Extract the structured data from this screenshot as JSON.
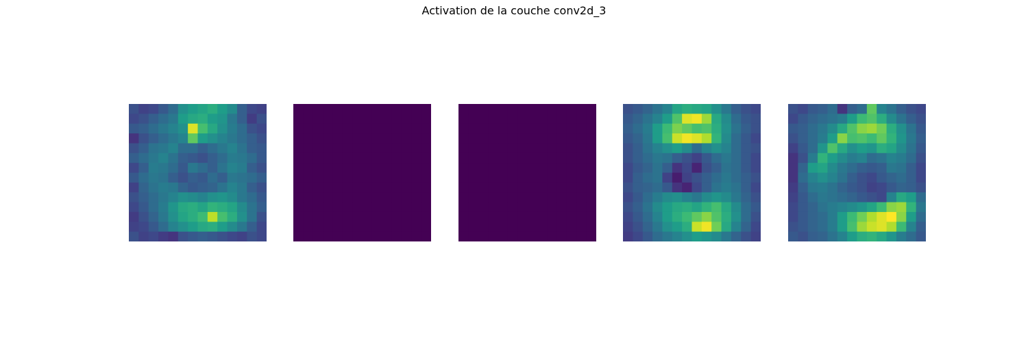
{
  "figure": {
    "title": "Activation de la couche conv2d_3"
  },
  "colormap": [
    "#440154",
    "#482878",
    "#3e4989",
    "#31688e",
    "#26828e",
    "#1f9e89",
    "#35b779",
    "#6ece58",
    "#b5de2b",
    "#fde725"
  ],
  "chart_data": {
    "type": "heatmap",
    "title": "Activation de la couche conv2d_3",
    "xlabel": "",
    "ylabel": "",
    "axes_visible": false,
    "grid": false,
    "colormap_name": "viridis",
    "value_range": [
      0,
      1
    ],
    "panels": [
      {
        "rows": 14,
        "cols": 14,
        "values": [
          [
            0.25,
            0.2,
            0.22,
            0.28,
            0.35,
            0.5,
            0.55,
            0.58,
            0.62,
            0.55,
            0.48,
            0.3,
            0.22,
            0.2
          ],
          [
            0.22,
            0.25,
            0.3,
            0.35,
            0.4,
            0.55,
            0.6,
            0.62,
            0.55,
            0.52,
            0.4,
            0.3,
            0.18,
            0.25
          ],
          [
            0.28,
            0.3,
            0.35,
            0.4,
            0.45,
            0.5,
            0.95,
            0.7,
            0.6,
            0.5,
            0.42,
            0.35,
            0.25,
            0.22
          ],
          [
            0.15,
            0.25,
            0.3,
            0.35,
            0.4,
            0.45,
            0.75,
            0.55,
            0.5,
            0.45,
            0.4,
            0.35,
            0.3,
            0.25
          ],
          [
            0.25,
            0.3,
            0.38,
            0.4,
            0.45,
            0.35,
            0.35,
            0.3,
            0.35,
            0.4,
            0.45,
            0.38,
            0.3,
            0.28
          ],
          [
            0.3,
            0.35,
            0.4,
            0.45,
            0.38,
            0.3,
            0.28,
            0.25,
            0.3,
            0.35,
            0.42,
            0.4,
            0.35,
            0.28
          ],
          [
            0.22,
            0.3,
            0.42,
            0.4,
            0.35,
            0.28,
            0.4,
            0.35,
            0.3,
            0.38,
            0.45,
            0.42,
            0.3,
            0.25
          ],
          [
            0.28,
            0.35,
            0.4,
            0.38,
            0.3,
            0.25,
            0.3,
            0.28,
            0.35,
            0.3,
            0.4,
            0.38,
            0.35,
            0.3
          ],
          [
            0.2,
            0.32,
            0.38,
            0.42,
            0.4,
            0.32,
            0.28,
            0.3,
            0.32,
            0.38,
            0.45,
            0.4,
            0.3,
            0.25
          ],
          [
            0.25,
            0.3,
            0.35,
            0.4,
            0.45,
            0.5,
            0.48,
            0.45,
            0.5,
            0.52,
            0.48,
            0.4,
            0.35,
            0.28
          ],
          [
            0.22,
            0.28,
            0.35,
            0.42,
            0.52,
            0.6,
            0.62,
            0.58,
            0.65,
            0.62,
            0.58,
            0.48,
            0.38,
            0.3
          ],
          [
            0.18,
            0.25,
            0.32,
            0.4,
            0.5,
            0.58,
            0.62,
            0.68,
            0.9,
            0.7,
            0.62,
            0.5,
            0.38,
            0.25
          ],
          [
            0.2,
            0.22,
            0.28,
            0.35,
            0.45,
            0.5,
            0.55,
            0.6,
            0.62,
            0.55,
            0.48,
            0.4,
            0.3,
            0.22
          ],
          [
            0.25,
            0.2,
            0.22,
            0.18,
            0.15,
            0.25,
            0.28,
            0.3,
            0.28,
            0.25,
            0.22,
            0.2,
            0.25,
            0.22
          ]
        ]
      },
      {
        "rows": 14,
        "cols": 14,
        "constant": 0.0
      },
      {
        "rows": 14,
        "cols": 14,
        "constant": 0.0
      },
      {
        "rows": 14,
        "cols": 14,
        "values": [
          [
            0.25,
            0.28,
            0.32,
            0.38,
            0.45,
            0.58,
            0.62,
            0.6,
            0.58,
            0.5,
            0.4,
            0.3,
            0.25,
            0.22
          ],
          [
            0.28,
            0.32,
            0.38,
            0.45,
            0.55,
            0.72,
            0.95,
            0.98,
            0.85,
            0.6,
            0.48,
            0.35,
            0.28,
            0.25
          ],
          [
            0.3,
            0.35,
            0.42,
            0.55,
            0.68,
            0.8,
            0.75,
            0.7,
            0.72,
            0.62,
            0.5,
            0.38,
            0.3,
            0.25
          ],
          [
            0.28,
            0.32,
            0.4,
            0.55,
            0.7,
            0.92,
            0.98,
            0.95,
            0.88,
            0.65,
            0.48,
            0.35,
            0.28,
            0.22
          ],
          [
            0.25,
            0.3,
            0.38,
            0.45,
            0.5,
            0.55,
            0.48,
            0.35,
            0.45,
            0.5,
            0.45,
            0.35,
            0.28,
            0.25
          ],
          [
            0.25,
            0.3,
            0.35,
            0.4,
            0.38,
            0.3,
            0.25,
            0.2,
            0.28,
            0.35,
            0.4,
            0.35,
            0.28,
            0.22
          ],
          [
            0.22,
            0.28,
            0.32,
            0.38,
            0.3,
            0.15,
            0.22,
            0.1,
            0.25,
            0.3,
            0.38,
            0.35,
            0.28,
            0.22
          ],
          [
            0.22,
            0.3,
            0.35,
            0.38,
            0.2,
            0.08,
            0.2,
            0.25,
            0.3,
            0.35,
            0.4,
            0.35,
            0.3,
            0.25
          ],
          [
            0.25,
            0.3,
            0.32,
            0.35,
            0.28,
            0.15,
            0.1,
            0.22,
            0.3,
            0.38,
            0.42,
            0.38,
            0.3,
            0.22
          ],
          [
            0.22,
            0.28,
            0.35,
            0.42,
            0.48,
            0.5,
            0.45,
            0.4,
            0.48,
            0.52,
            0.48,
            0.4,
            0.32,
            0.25
          ],
          [
            0.25,
            0.3,
            0.38,
            0.48,
            0.55,
            0.6,
            0.62,
            0.58,
            0.65,
            0.7,
            0.6,
            0.48,
            0.35,
            0.28
          ],
          [
            0.22,
            0.28,
            0.35,
            0.45,
            0.55,
            0.62,
            0.68,
            0.75,
            0.82,
            0.72,
            0.62,
            0.5,
            0.35,
            0.25
          ],
          [
            0.2,
            0.25,
            0.32,
            0.4,
            0.5,
            0.55,
            0.62,
            0.92,
            0.98,
            0.78,
            0.6,
            0.45,
            0.32,
            0.22
          ],
          [
            0.18,
            0.22,
            0.28,
            0.35,
            0.4,
            0.45,
            0.5,
            0.55,
            0.52,
            0.48,
            0.4,
            0.32,
            0.25,
            0.2
          ]
        ]
      },
      {
        "rows": 14,
        "cols": 14,
        "values": [
          [
            0.25,
            0.22,
            0.28,
            0.3,
            0.35,
            0.15,
            0.3,
            0.35,
            0.75,
            0.45,
            0.38,
            0.3,
            0.25,
            0.22
          ],
          [
            0.22,
            0.28,
            0.32,
            0.35,
            0.38,
            0.42,
            0.55,
            0.68,
            0.72,
            0.62,
            0.48,
            0.38,
            0.3,
            0.25
          ],
          [
            0.28,
            0.3,
            0.35,
            0.4,
            0.48,
            0.6,
            0.72,
            0.82,
            0.85,
            0.78,
            0.62,
            0.5,
            0.38,
            0.28
          ],
          [
            0.25,
            0.3,
            0.35,
            0.42,
            0.55,
            0.82,
            0.7,
            0.72,
            0.68,
            0.75,
            0.65,
            0.52,
            0.4,
            0.3
          ],
          [
            0.2,
            0.28,
            0.35,
            0.52,
            0.72,
            0.6,
            0.5,
            0.55,
            0.52,
            0.62,
            0.58,
            0.48,
            0.38,
            0.28
          ],
          [
            0.15,
            0.25,
            0.42,
            0.65,
            0.55,
            0.48,
            0.42,
            0.45,
            0.35,
            0.38,
            0.45,
            0.42,
            0.35,
            0.25
          ],
          [
            0.15,
            0.32,
            0.55,
            0.58,
            0.48,
            0.4,
            0.35,
            0.3,
            0.28,
            0.3,
            0.4,
            0.38,
            0.3,
            0.22
          ],
          [
            0.15,
            0.35,
            0.45,
            0.5,
            0.45,
            0.38,
            0.3,
            0.25,
            0.22,
            0.28,
            0.32,
            0.35,
            0.3,
            0.22
          ],
          [
            0.18,
            0.3,
            0.4,
            0.42,
            0.38,
            0.32,
            0.28,
            0.25,
            0.2,
            0.22,
            0.28,
            0.32,
            0.3,
            0.25
          ],
          [
            0.2,
            0.28,
            0.35,
            0.4,
            0.38,
            0.35,
            0.32,
            0.28,
            0.25,
            0.22,
            0.45,
            0.6,
            0.55,
            0.35
          ],
          [
            0.22,
            0.28,
            0.32,
            0.38,
            0.42,
            0.45,
            0.48,
            0.52,
            0.58,
            0.68,
            0.82,
            0.85,
            0.65,
            0.4
          ],
          [
            0.22,
            0.28,
            0.32,
            0.35,
            0.42,
            0.55,
            0.68,
            0.78,
            0.88,
            0.95,
            1.0,
            0.82,
            0.55,
            0.35
          ],
          [
            0.25,
            0.28,
            0.32,
            0.35,
            0.42,
            0.55,
            0.7,
            0.85,
            0.92,
            0.95,
            0.88,
            0.68,
            0.45,
            0.3
          ],
          [
            0.28,
            0.25,
            0.3,
            0.32,
            0.38,
            0.45,
            0.55,
            0.62,
            0.65,
            0.6,
            0.52,
            0.42,
            0.35,
            0.28
          ]
        ]
      }
    ]
  }
}
